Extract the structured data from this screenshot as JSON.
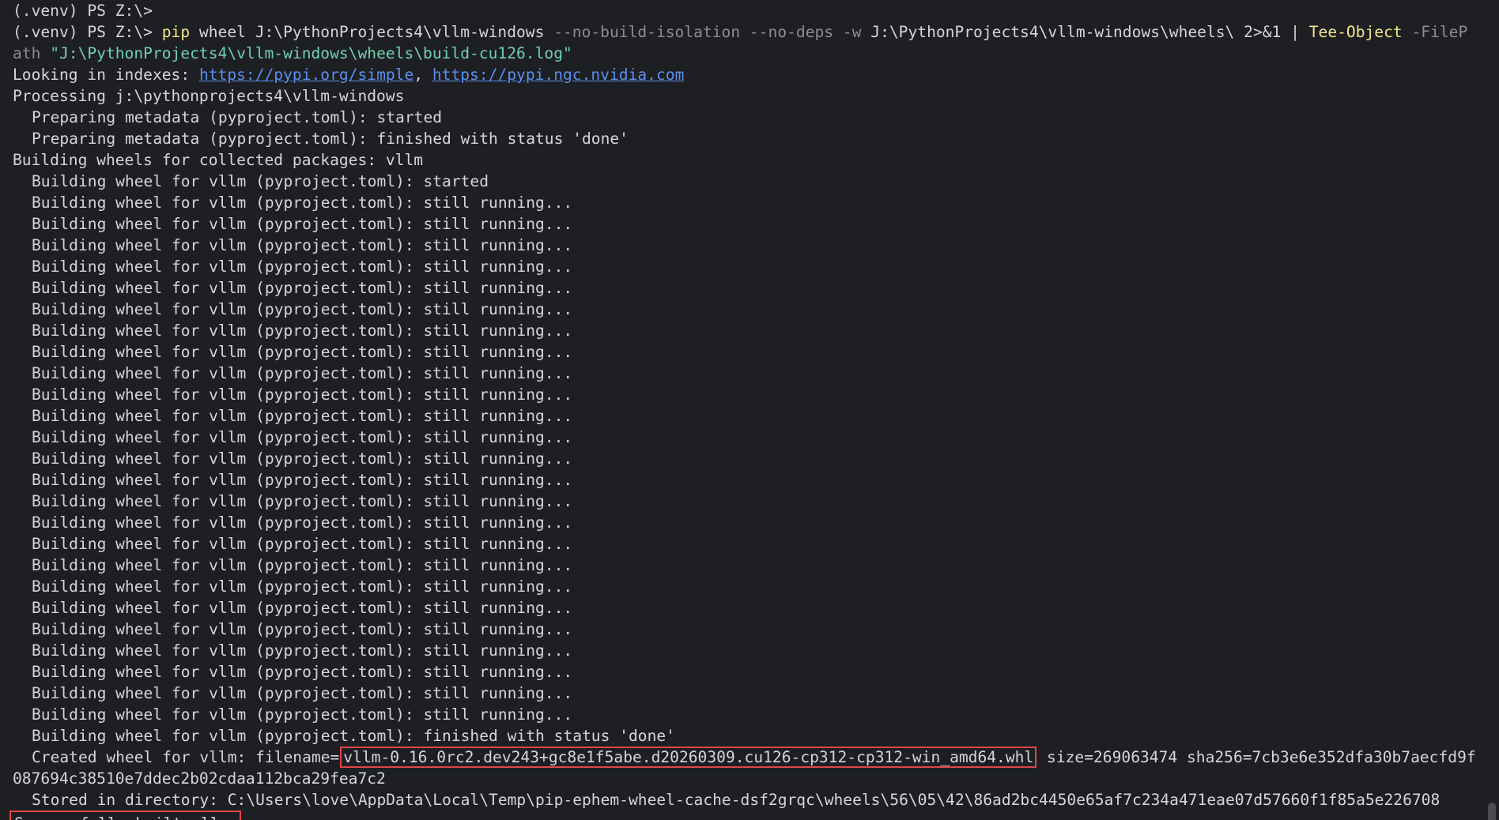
{
  "terminal": {
    "prompt_line_1": "(.venv) PS Z:\\>",
    "command": {
      "prompt": "(.venv) PS Z:\\> ",
      "cmd": "pip",
      "args1": " wheel J:\\PythonProjects4\\vllm-windows ",
      "flag1": "--no-build-isolation --no-deps -w",
      "args2": " J:\\PythonProjects4\\vllm-windows\\wheels\\ 2>&1 | ",
      "cmd2": "Tee-Object",
      "flag2": " -FileP",
      "wrap_start": "ath ",
      "string": "\"J:\\PythonProjects4\\vllm-windows\\wheels\\build-cu126.log\""
    },
    "indexes": {
      "prefix": "Looking in indexes: ",
      "url1": "https://pypi.org/simple",
      "sep": ", ",
      "url2": "https://pypi.ngc.nvidia.com"
    },
    "processing": "Processing j:\\pythonprojects4\\vllm-windows",
    "meta_started": "Preparing metadata (pyproject.toml): started",
    "meta_done": "Preparing metadata (pyproject.toml): finished with status 'done'",
    "building_collected": "Building wheels for collected packages: vllm",
    "build_started": "Building wheel for vllm (pyproject.toml): started",
    "running_lines": [
      "Building wheel for vllm (pyproject.toml): still running...",
      "Building wheel for vllm (pyproject.toml): still running...",
      "Building wheel for vllm (pyproject.toml): still running...",
      "Building wheel for vllm (pyproject.toml): still running...",
      "Building wheel for vllm (pyproject.toml): still running...",
      "Building wheel for vllm (pyproject.toml): still running...",
      "Building wheel for vllm (pyproject.toml): still running...",
      "Building wheel for vllm (pyproject.toml): still running...",
      "Building wheel for vllm (pyproject.toml): still running...",
      "Building wheel for vllm (pyproject.toml): still running...",
      "Building wheel for vllm (pyproject.toml): still running...",
      "Building wheel for vllm (pyproject.toml): still running...",
      "Building wheel for vllm (pyproject.toml): still running...",
      "Building wheel for vllm (pyproject.toml): still running...",
      "Building wheel for vllm (pyproject.toml): still running...",
      "Building wheel for vllm (pyproject.toml): still running...",
      "Building wheel for vllm (pyproject.toml): still running...",
      "Building wheel for vllm (pyproject.toml): still running...",
      "Building wheel for vllm (pyproject.toml): still running...",
      "Building wheel for vllm (pyproject.toml): still running...",
      "Building wheel for vllm (pyproject.toml): still running...",
      "Building wheel for vllm (pyproject.toml): still running...",
      "Building wheel for vllm (pyproject.toml): still running...",
      "Building wheel for vllm (pyproject.toml): still running...",
      "Building wheel for vllm (pyproject.toml): still running..."
    ],
    "build_done": "Building wheel for vllm (pyproject.toml): finished with status 'done'",
    "created": {
      "prefix": "Created wheel for vllm: filename=",
      "filename": "vllm-0.16.0rc2.dev243+gc8e1f5abe.d20260309.cu126-cp312-cp312-win_amd64.whl",
      "suffix": " size=269063474 sha256=7cb3e6e352dfa30b7aecfd9f",
      "wrap": "087694c38510e7ddec2b02cdaa112bca29fea7c2"
    },
    "stored": "Stored in directory: C:\\Users\\love\\AppData\\Local\\Temp\\pip-ephem-wheel-cache-dsf2grqc\\wheels\\56\\05\\42\\86ad2bc4450e65af7c234a471eae07d57660f1f85a5e226708",
    "success": "Successfully built vllm",
    "colors": {
      "background": "#1e1f22",
      "text": "#d4d6dc",
      "command": "#f0e68c",
      "param": "#8b8d95",
      "string": "#6fd0b0",
      "link": "#5a8ff0",
      "highlight_border": "#e2454a"
    }
  }
}
